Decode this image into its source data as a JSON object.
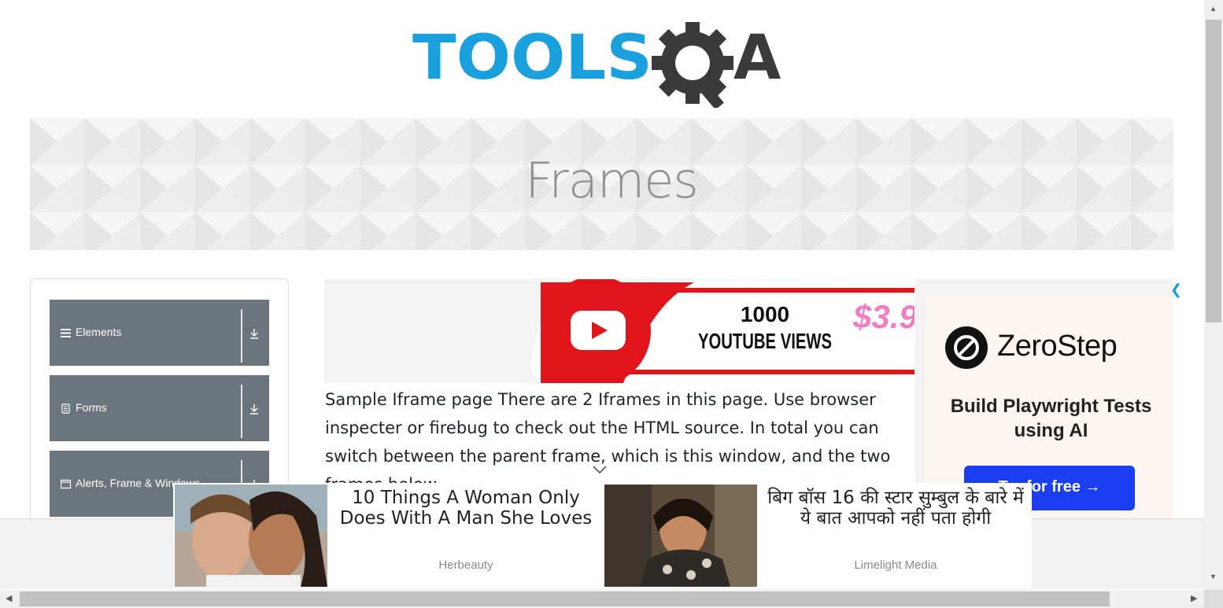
{
  "logo": {
    "text_part1": "TOOLS",
    "text_part2": "A"
  },
  "banner": {
    "title": "Frames"
  },
  "sidebar": {
    "groups": [
      {
        "label": "Elements",
        "icon": "hamburger-icon"
      },
      {
        "label": "Forms",
        "icon": "document-icon"
      },
      {
        "label": "Alerts, Frame & Windows",
        "icon": "window-icon"
      }
    ]
  },
  "ad_top": {
    "line1": "1000",
    "line2": "YOUTUBE VIEWS",
    "price": "$3.9"
  },
  "main": {
    "description": "Sample Iframe page There are 2 Iframes in this page. Use browser inspecter or firebug to check out the HTML source. In total you can switch between the parent frame, which is this window, and the two frames below"
  },
  "right_ad": {
    "brand": "ZeroStep",
    "tagline": "Build Playwright Tests using AI",
    "cta": "Try for free →"
  },
  "bottom_ads": [
    {
      "title": "10 Things A Woman Only Does With A Man She Loves",
      "source": "Herbeauty"
    },
    {
      "title": "बिग बॉस 16 की स्टार सुम्बुल के बारे में ये बात आपको नहीं पता होगी",
      "source": "Limelight Media"
    }
  ],
  "colors": {
    "brand_blue": "#1aa0dc",
    "brand_dark": "#3a3a3a",
    "sidebar_bg": "#6c757d",
    "cta_blue": "#1a3ef0",
    "youtube_red": "#e0141b"
  }
}
